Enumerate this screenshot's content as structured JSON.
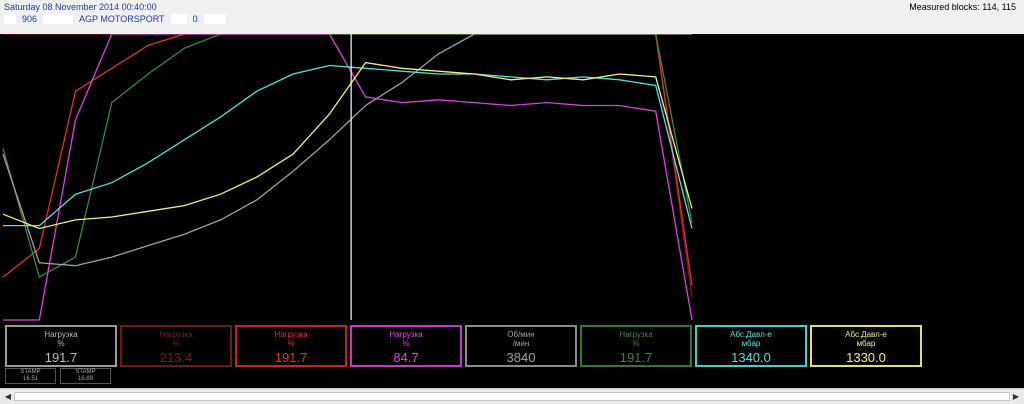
{
  "header": {
    "date": "Saturday 08 November 2014 00:40:00",
    "field1": "906",
    "company": "AGP MOTORSPORT",
    "field2": "0",
    "measured": "Measured blocks: 114, 115"
  },
  "channels": [
    {
      "name": "Нагрузка",
      "unit": "%",
      "value": "191.7",
      "color": "#bbbbbb",
      "border": "#9a9a9a"
    },
    {
      "name": "Нагрузка",
      "unit": "%",
      "value": "213.4",
      "color": "#7a1c1c",
      "border": "#6a1a1a"
    },
    {
      "name": "Нагрузка",
      "unit": "%",
      "value": "191.7",
      "color": "#e03030",
      "border": "#c82222"
    },
    {
      "name": "Нагрузка",
      "unit": "%",
      "value": "84.7",
      "color": "#e040e0",
      "border": "#cc33cc"
    },
    {
      "name": "Об/мин",
      "unit": "/мин",
      "value": "3840",
      "color": "#a0a0a0",
      "border": "#8a8a8a"
    },
    {
      "name": "Нагрузка",
      "unit": "%",
      "value": "191.7",
      "color": "#3a8a3a",
      "border": "#2f7a2f"
    },
    {
      "name": "Абс.Давл-е",
      "unit": "мбар",
      "value": "1340.0",
      "color": "#50e0e0",
      "border": "#40d0d0"
    },
    {
      "name": "Абс.Давл-е",
      "unit": "мбар",
      "value": "1330.0",
      "color": "#f0f080",
      "border": "#e0e070"
    }
  ],
  "stamps": [
    {
      "label": "STAMP",
      "value": "16.51"
    },
    {
      "label": "STAMP",
      "value": "16.89"
    }
  ],
  "chart_data": {
    "type": "line",
    "title": "",
    "xlabel": "",
    "ylabel": "",
    "cursor_index": 9,
    "ylim": [
      0,
      100
    ],
    "series": [
      {
        "color": "#7a1c1c",
        "values": [
          100,
          100,
          100,
          100,
          100,
          100,
          100,
          100,
          100,
          100,
          100,
          100,
          100,
          100,
          100,
          100,
          100,
          100,
          100,
          8
        ]
      },
      {
        "color": "#e03030",
        "values": [
          15,
          25,
          80,
          88,
          96,
          100,
          100,
          100,
          100,
          100,
          100,
          100,
          100,
          100,
          100,
          100,
          100,
          100,
          100,
          12
        ]
      },
      {
        "color": "#3a8a3a",
        "values": [
          60,
          15,
          22,
          76,
          86,
          95,
          100,
          100,
          100,
          100,
          100,
          100,
          100,
          100,
          100,
          100,
          100,
          100,
          100,
          34
        ]
      },
      {
        "color": "#e040e0",
        "values": [
          0,
          0,
          70,
          100,
          100,
          100,
          100,
          100,
          100,
          100,
          78,
          76,
          77,
          76,
          75,
          76,
          75,
          75,
          73,
          0
        ]
      },
      {
        "color": "#a0a0a0",
        "values": [
          58,
          20,
          19,
          22,
          26,
          30,
          35,
          42,
          52,
          63,
          75,
          83,
          93,
          100,
          100,
          100,
          100,
          100,
          100,
          100
        ]
      },
      {
        "color": "#50e0e0",
        "values": [
          33,
          33,
          44,
          48,
          55,
          63,
          71,
          80,
          86,
          89,
          88,
          87,
          86,
          86,
          85,
          84,
          85,
          84,
          82,
          32
        ]
      },
      {
        "color": "#f0f080",
        "values": [
          37,
          32,
          35,
          36,
          38,
          40,
          44,
          50,
          58,
          72,
          90,
          88,
          87,
          86,
          84,
          85,
          84,
          86,
          85,
          39
        ]
      }
    ]
  }
}
